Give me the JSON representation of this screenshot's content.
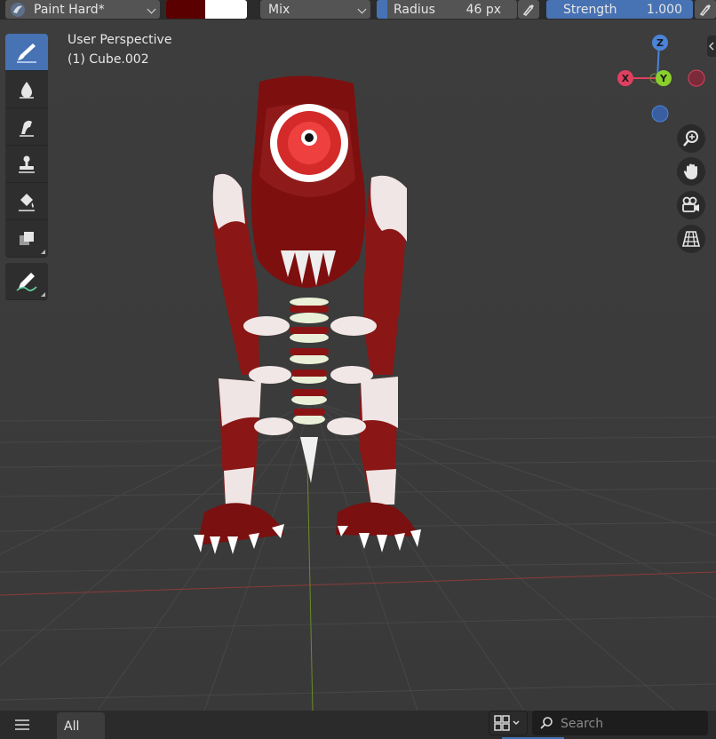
{
  "header": {
    "brush_name": "Paint Hard*",
    "color_primary": "#5a0000",
    "color_secondary": "#ffffff",
    "blend_mode": "Mix",
    "radius_label": "Radius",
    "radius_value": "46 px",
    "strength_label": "Strength",
    "strength_value": "1.000",
    "accent": "#4772b3"
  },
  "toolbar": {
    "tools": [
      {
        "icon": "draw-brush-icon",
        "active": true
      },
      {
        "icon": "soften-drop-icon",
        "active": false
      },
      {
        "icon": "smear-icon",
        "active": false
      },
      {
        "icon": "clone-stamp-icon",
        "active": false
      },
      {
        "icon": "fill-bucket-icon",
        "active": false
      },
      {
        "icon": "mask-icon",
        "active": false
      },
      {
        "icon": "annotate-pencil-icon",
        "active": false
      }
    ]
  },
  "viewport": {
    "view_name": "User Perspective",
    "object_name": "(1) Cube.002",
    "gizmo": {
      "z": "Z",
      "x": "X",
      "y": "Y"
    },
    "nav_buttons": [
      "zoom-icon",
      "hand-pan-icon",
      "camera-icon",
      "perspective-grid-icon"
    ]
  },
  "footer": {
    "tab_all": "All",
    "search_placeholder": "Search"
  }
}
